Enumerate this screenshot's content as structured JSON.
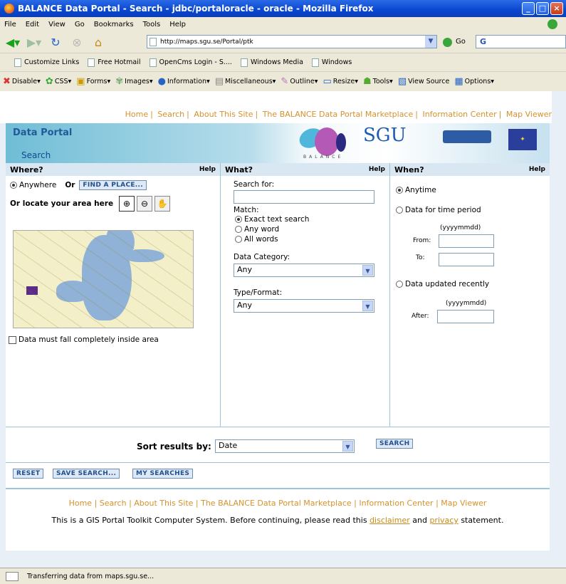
{
  "window": {
    "title": "BALANCE Data Portal - Search - jdbc/portaloracle - oracle - Mozilla Firefox"
  },
  "menu": [
    "File",
    "Edit",
    "View",
    "Go",
    "Bookmarks",
    "Tools",
    "Help"
  ],
  "nav": {
    "url": "http://maps.sgu.se/Portal/ptk",
    "go_label": "Go",
    "search_value": "G"
  },
  "bookmarks": [
    "Customize Links",
    "Free Hotmail",
    "OpenCms Login - S....",
    "Windows Media",
    "Windows"
  ],
  "devbar": [
    "Disable▾",
    "CSS▾",
    "Forms▾",
    "Images▾",
    "Information▾",
    "Miscellaneous▾",
    "Outline▾",
    "Resize▾",
    "Tools▾",
    "View Source",
    "Options▾"
  ],
  "site": {
    "links": [
      "Home",
      "Search",
      "About This Site",
      "The BALANCE Data Portal Marketplace",
      "Information Center",
      "Map Viewer"
    ],
    "banner_title": "Data Portal",
    "banner_sub": "Search",
    "balance_text": "BALANCE",
    "sgu": "SGU"
  },
  "where": {
    "title": "Where?",
    "help": "Help",
    "anywhere": "Anywhere",
    "or": "Or",
    "find_place": "FIND A PLACE...",
    "locate": "Or locate your area here",
    "inside": "Data must fall completely inside area"
  },
  "what": {
    "title": "What?",
    "help": "Help",
    "search_for": "Search for:",
    "match": "Match:",
    "match_options": [
      "Exact text search",
      "Any word",
      "All words"
    ],
    "category_label": "Data Category:",
    "category_value": "Any",
    "type_label": "Type/Format:",
    "type_value": "Any"
  },
  "when": {
    "title": "When?",
    "help": "Help",
    "anytime": "Anytime",
    "period": "Data for time period",
    "format": "(yyyymmdd)",
    "from": "From:",
    "to": "To:",
    "updated": "Data updated recently",
    "format2": "(yyyymmdd)",
    "after": "After:"
  },
  "sort": {
    "label": "Sort results by:",
    "value": "Date",
    "search_button": "SEARCH"
  },
  "actions": {
    "reset": "RESET",
    "save": "SAVE SEARCH...",
    "my": "MY SEARCHES"
  },
  "footer": {
    "links": [
      "Home",
      "Search",
      "About This Site",
      "The BALANCE Data Portal Marketplace",
      "Information Center",
      "Map Viewer"
    ],
    "disclaimer_pre": "This is a GIS Portal Toolkit Computer System. Before continuing, please read this",
    "disclaimer_link": "disclaimer",
    "and": "and",
    "privacy_link": "privacy",
    "disclaimer_post": "statement."
  },
  "status": "Transferring data from maps.sgu.se..."
}
